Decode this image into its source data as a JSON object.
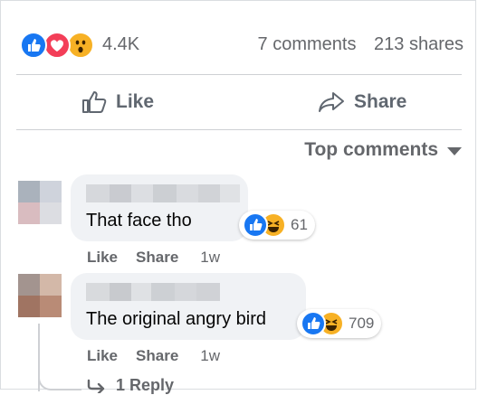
{
  "summary": {
    "reaction_count": "4.4K",
    "comments": "7 comments",
    "shares": "213 shares",
    "reaction_icons": [
      "like-icon",
      "love-icon",
      "wow-icon"
    ]
  },
  "actions": {
    "like_label": "Like",
    "share_label": "Share"
  },
  "sort": {
    "label": "Top comments"
  },
  "comments": [
    {
      "text": "That face tho",
      "reaction_count": "61",
      "reaction_icons": [
        "like-icon",
        "haha-icon"
      ],
      "like_label": "Like",
      "share_label": "Share",
      "time": "1w"
    },
    {
      "text": "The original angry bird",
      "reaction_count": "709",
      "reaction_icons": [
        "like-icon",
        "haha-icon"
      ],
      "like_label": "Like",
      "share_label": "Share",
      "time": "1w",
      "replies_label": "1 Reply"
    }
  ],
  "colors": {
    "like_blue": "#1877f2",
    "love_red": "#f33e58",
    "yellow": "#f7b125",
    "bubble": "#f0f2f5",
    "divider": "#ced0d4"
  }
}
